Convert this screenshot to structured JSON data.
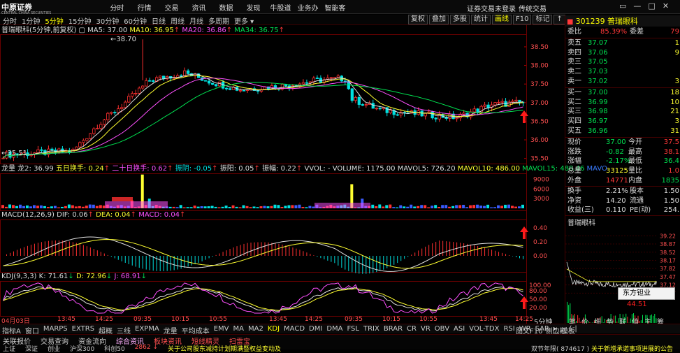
{
  "app": {
    "logo_text": "中原证券",
    "logo_sub": "CENTRAL CHINA SECURITIES",
    "menu": [
      "分时",
      "行情",
      "交易",
      "资讯",
      "数据",
      "发现",
      "牛股道",
      "业务办理",
      "智能客服"
    ],
    "status": "证券交易未登录",
    "mode": "传统交易",
    "window_buttons": [
      "▭",
      "—",
      "□",
      "✕"
    ]
  },
  "toolbar": {
    "periods": [
      {
        "label": "分时",
        "active": false
      },
      {
        "label": "1分钟",
        "active": false
      },
      {
        "label": "5分钟",
        "active": true
      },
      {
        "label": "15分钟",
        "active": false
      },
      {
        "label": "30分钟",
        "active": false
      },
      {
        "label": "60分钟",
        "active": false
      },
      {
        "label": "日线",
        "active": false
      },
      {
        "label": "周线",
        "active": false
      },
      {
        "label": "月线",
        "active": false
      },
      {
        "label": "多周期",
        "active": false
      },
      {
        "label": "更多 ▾",
        "active": false
      }
    ],
    "tools": [
      {
        "label": "复权",
        "active": false
      },
      {
        "label": "叠加",
        "active": false
      },
      {
        "label": "多股",
        "active": false
      },
      {
        "label": "统计",
        "active": false
      },
      {
        "label": "画线",
        "active": true
      },
      {
        "label": "F10",
        "active": false
      },
      {
        "label": "标记",
        "active": false
      },
      {
        "label": "↑",
        "active": false
      }
    ]
  },
  "kline": {
    "title": "普瑞眼科(5分钟,前复权)",
    "ma5": "MA5: 37.00",
    "ma10": "MA10: 36.95",
    "ma20": "MA20: 36.86",
    "ma34": "MA34: 36.75",
    "high_label": "38.70",
    "low_label": "35.51",
    "yticks": [
      "38.50",
      "38.00",
      "37.50",
      "37.00",
      "36.50",
      "36.00",
      "35.50"
    ]
  },
  "vol": {
    "title": "龙量 龙2: 36.99",
    "items": [
      {
        "label": "五日换手: 0.24",
        "color": "#ffff30"
      },
      {
        "label": "二十日换手: 0.62",
        "color": "#ff50ff"
      },
      {
        "label": "振阴: -0.05",
        "color": "#00e0e0"
      },
      {
        "label": "振阳: 0.05",
        "color": "#ddd"
      },
      {
        "label": "振幅: 0.22",
        "color": "#ddd"
      },
      {
        "label": "VVOL: - VOLUME: 1175.00",
        "color": "#ddd"
      },
      {
        "label": "MAVOL5: 726.20",
        "color": "#ddd"
      },
      {
        "label": "MAVOL10: 486.00",
        "color": "#ffff30"
      },
      {
        "label": "MAVOL15: 488.46",
        "color": "#00e050"
      },
      {
        "label": "MAVO",
        "color": "#3a7cff"
      }
    ],
    "yticks": [
      "9000",
      "6000",
      "3000"
    ]
  },
  "macd": {
    "title": "MACD(12,26,9)",
    "dif": "DIF: 0.06",
    "dea": "DEA: 0.04",
    "macd": "MACD: 0.04",
    "yticks": [
      "0.40",
      "0.20",
      "0.00"
    ]
  },
  "kdj": {
    "title": "KDJ(9,3,3)",
    "k": "K: 71.61",
    "d": "D: 72.96",
    "j": "J: 68.91",
    "yticks": [
      "100.00",
      "80.00",
      "50.00",
      "20.00"
    ]
  },
  "xaxis": {
    "labels": [
      "04月03日",
      "13:45",
      "14:25",
      "09:35",
      "10:15",
      "10:55",
      "13:45",
      "14:25",
      "09:35",
      "10:15",
      "10:55",
      "13:45",
      "14:25"
    ],
    "right_label": "5分钟"
  },
  "quote": {
    "code": "301239",
    "name": "普瑞眼科",
    "weibi_label": "委比",
    "weibi": "85.39%",
    "weicha_label": "委差",
    "weicha": "79",
    "asks": [
      {
        "label": "卖五",
        "price": "37.07",
        "vol": "1"
      },
      {
        "label": "卖四",
        "price": "37.06",
        "vol": "9"
      },
      {
        "label": "卖三",
        "price": "37.05",
        "vol": ""
      },
      {
        "label": "卖二",
        "price": "37.03",
        "vol": ""
      },
      {
        "label": "卖一",
        "price": "37.02",
        "vol": "3"
      }
    ],
    "bids": [
      {
        "label": "买一",
        "price": "37.00",
        "vol": "18"
      },
      {
        "label": "买二",
        "price": "36.99",
        "vol": "10"
      },
      {
        "label": "买三",
        "price": "36.98",
        "vol": "21"
      },
      {
        "label": "买四",
        "price": "36.97",
        "vol": "3"
      },
      {
        "label": "买五",
        "price": "36.96",
        "vol": "31"
      }
    ],
    "stats": [
      {
        "l1": "现价",
        "v1": "37.00",
        "c1": "grn",
        "l2": "今开",
        "v2": "37.5",
        "c2": "red"
      },
      {
        "l1": "涨跌",
        "v1": "-0.82",
        "c1": "grn",
        "l2": "最高",
        "v2": "38.1",
        "c2": "red"
      },
      {
        "l1": "涨幅",
        "v1": "-2.17%",
        "c1": "grn",
        "l2": "最低",
        "v2": "36.4",
        "c2": "grn"
      },
      {
        "l1": "总量",
        "v1": "33125",
        "c1": "yel",
        "l2": "量比",
        "v2": "1.0",
        "c2": "red"
      },
      {
        "l1": "外盘",
        "v1": "14771",
        "c1": "red",
        "l2": "内盘",
        "v2": "1835",
        "c2": "grn"
      }
    ],
    "stats2": [
      {
        "l1": "换手",
        "v1": "2.21%",
        "l2": "股本",
        "v2": "1.50"
      },
      {
        "l1": "净资",
        "v1": "14.20",
        "l2": "流通",
        "v2": "1.50"
      },
      {
        "l1": "收益(三)",
        "v1": "0.110",
        "l2": "PE(动)",
        "v2": "254."
      }
    ]
  },
  "mini": {
    "title": "普瑞眼科",
    "yticks": [
      "39.22",
      "38.87",
      "38.52",
      "38.17",
      "37.82",
      "37.47",
      "37.12",
      "36.77"
    ],
    "tooltip_name": "东方钽业",
    "tooltip_value": "44.51"
  },
  "right_tabs": [
    "笔",
    "价",
    "细",
    "势",
    "联",
    "值",
    "主",
    "筹"
  ],
  "indicators": [
    {
      "label": "指标A",
      "active": false
    },
    {
      "label": "窗口",
      "active": false
    },
    {
      "label": "MARPS",
      "active": false
    },
    {
      "label": "EXTRS",
      "active": false
    },
    {
      "label": "超概",
      "active": false
    },
    {
      "label": "三线",
      "active": false
    },
    {
      "label": "EXPMA",
      "active": false
    },
    {
      "label": "龙量",
      "active": false
    },
    {
      "label": "平均成本",
      "active": false
    },
    {
      "label": "EMV",
      "active": false
    },
    {
      "label": "MA",
      "active": false
    },
    {
      "label": "MA2",
      "active": false
    },
    {
      "label": "KDJ",
      "active": true
    },
    {
      "label": "MACD",
      "active": false
    },
    {
      "label": "DMI",
      "active": false
    },
    {
      "label": "DMA",
      "active": false
    },
    {
      "label": "FSL",
      "active": false
    },
    {
      "label": "TRIX",
      "active": false
    },
    {
      "label": "BRAR",
      "active": false
    },
    {
      "label": "CR",
      "active": false
    },
    {
      "label": "VR",
      "active": false
    },
    {
      "label": "OBV",
      "active": false
    },
    {
      "label": "ASI",
      "active": false
    },
    {
      "label": "VOL-TDX",
      "active": false
    },
    {
      "label": "RSI",
      "active": false
    },
    {
      "label": "WR",
      "active": false
    },
    {
      "label": "SAR",
      "active": false
    },
    {
      "label": "▸",
      "active": false
    },
    {
      "label": "模板",
      "active": false
    }
  ],
  "right_bottom": [
    "图文F10",
    "侧边栏",
    "(",
    "|"
  ],
  "newsbar": [
    "关联报价",
    "交易查询",
    "资金流向",
    "综合资讯",
    "板块资讯",
    "短线精灵",
    "扫雷宝"
  ],
  "newsbar_active": [
    "综合资讯",
    "板块资讯",
    "短线精灵",
    "扫雷宝"
  ],
  "news_line": [
    "上证",
    "深证",
    "创业",
    "沪深300",
    "科创50",
    "2862 ↓",
    "关于公司股东减持计划期满暨权益变动及"
  ],
  "news_right": "双节年限( 874617 )",
  "news_right2": "关于新增承诺事项进展的公告"
}
